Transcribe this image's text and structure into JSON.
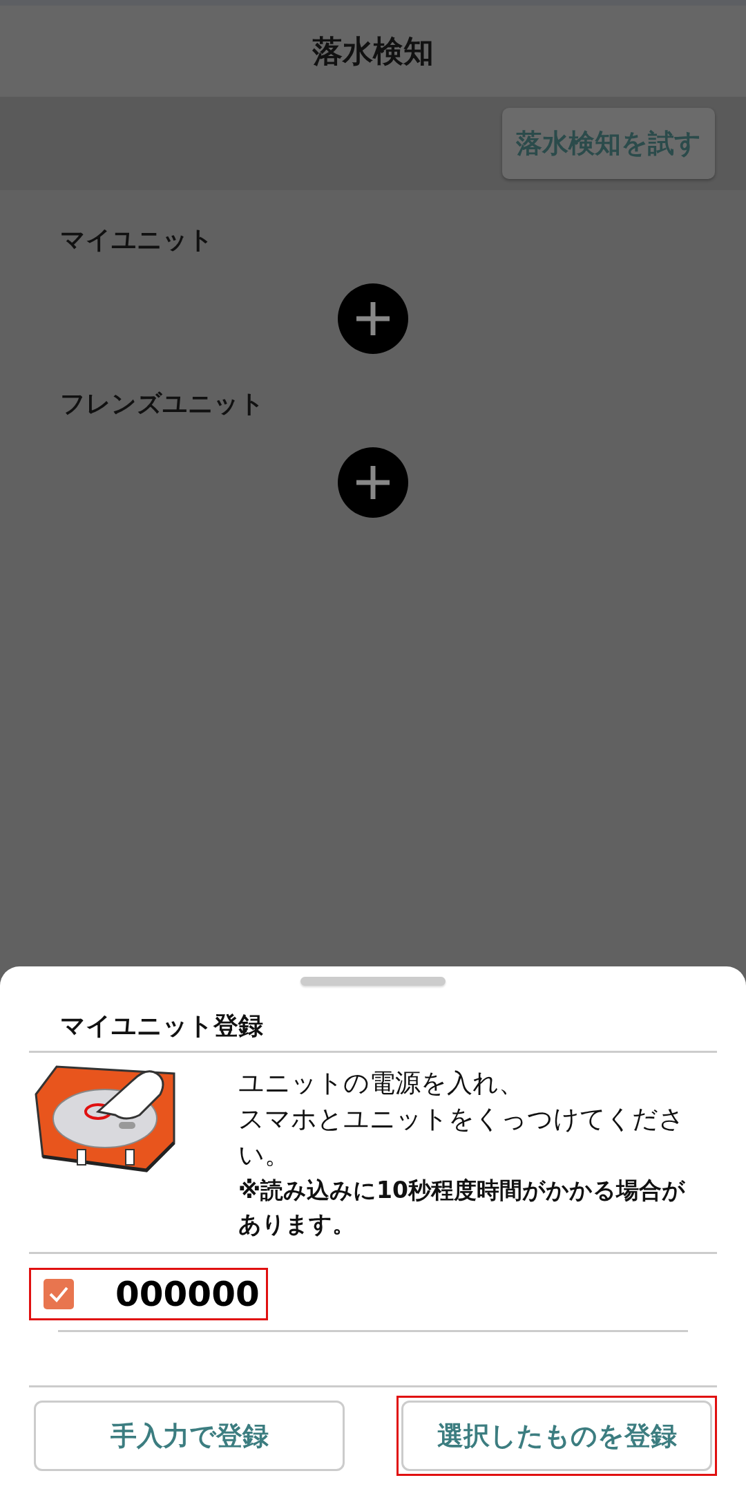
{
  "header": {
    "title": "落水検知"
  },
  "toolbar": {
    "test_button": "落水検知を試す"
  },
  "sections": [
    {
      "label": "マイユニット"
    },
    {
      "label": "フレンズユニット"
    }
  ],
  "sheet": {
    "title": "マイユニット登録",
    "instruction_lines": [
      "ユニットの電源を入れ、",
      "スマホとユニットをくっつけてください。"
    ],
    "note": "※読み込みに10秒程度時間がかかる場合があります。",
    "units": [
      {
        "code": "000000",
        "checked": true,
        "highlighted": true
      }
    ],
    "buttons": [
      {
        "label": "手入力で登録",
        "highlighted": false
      },
      {
        "label": "選択したものを登録",
        "highlighted": true
      }
    ]
  }
}
